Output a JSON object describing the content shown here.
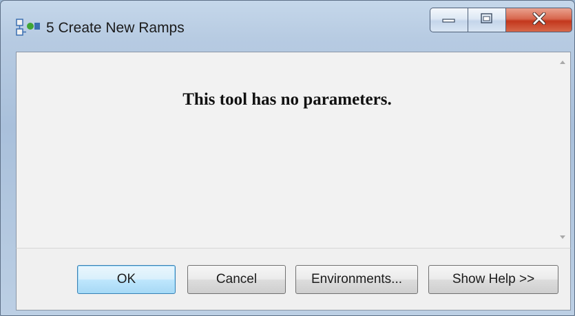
{
  "window": {
    "title": "5 Create New Ramps",
    "icon": "model-tool-icon",
    "caption_buttons": [
      "minimize-icon",
      "maximize-icon",
      "close-icon"
    ]
  },
  "content": {
    "message": "This tool has no parameters."
  },
  "footer": {
    "ok_label": "OK",
    "cancel_label": "Cancel",
    "environments_label": "Environments...",
    "show_help_label": "Show Help >>"
  },
  "colors": {
    "close_button": "#c3371d",
    "default_button_border": "#3c7fb1",
    "content_background": "#f2f2f2"
  }
}
